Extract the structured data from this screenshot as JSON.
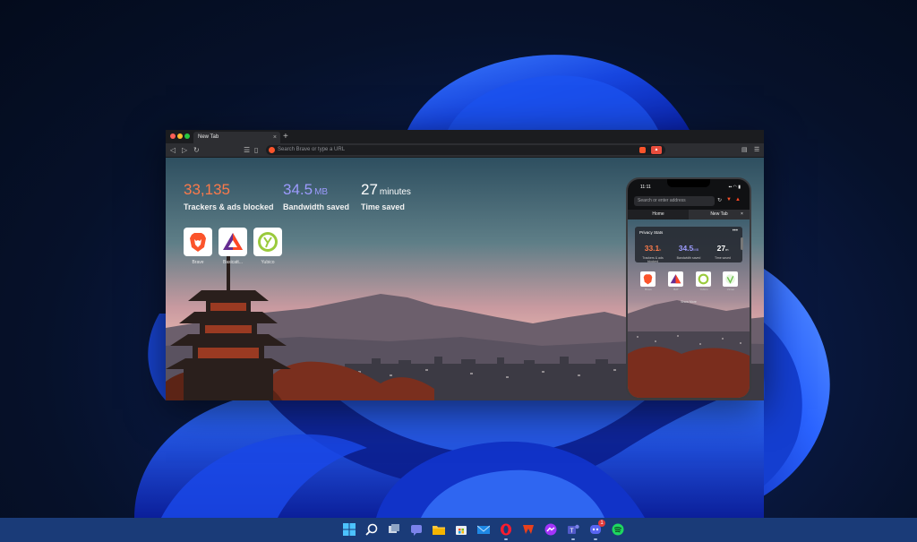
{
  "browser": {
    "tab_title": "New Tab",
    "tab_close": "×",
    "new_tab": "+",
    "url_placeholder": "Search Brave or type a URL",
    "nav": {
      "back": "◁",
      "forward": "▷",
      "reload": "↻",
      "bookmarks": "☰",
      "bookmark_add": "▯"
    },
    "menu": "☰",
    "wallet": "▤"
  },
  "stats": {
    "trackers": {
      "value": "33,135",
      "unit": "",
      "label": "Trackers & ads blocked",
      "color": "#fb7a4b"
    },
    "bandwidth": {
      "value": "34.5",
      "unit": "MB",
      "label": "Bandwidth saved",
      "color": "#9c9bfd"
    },
    "time": {
      "value": "27",
      "unit": "minutes",
      "label": "Time saved",
      "color": "#ffffff"
    }
  },
  "top_sites": [
    {
      "label": "Brave",
      "icon": "brave-lion-icon"
    },
    {
      "label": "Basicatt...",
      "icon": "bat-triangle-icon"
    },
    {
      "label": "Yubico",
      "icon": "yubico-icon"
    }
  ],
  "phone": {
    "time": "11:11",
    "signal": "▪▪ ◠ ▮",
    "url_placeholder": "Search or enter address",
    "tabs": [
      "Home",
      "New Tab"
    ],
    "tab_close": "×",
    "card_title": "Privacy Stats",
    "card_more": "•••",
    "stats": [
      {
        "value": "33.1",
        "unit": "k",
        "label": "Trackers & ads blocked",
        "color": "#fb7a4b"
      },
      {
        "value": "34.5",
        "unit": "MB",
        "label": "Bandwidth saved",
        "color": "#9c9bfd"
      },
      {
        "value": "27",
        "unit": "m",
        "label": "Time saved",
        "color": "#ffffff"
      }
    ],
    "tiles": [
      "Brave",
      "BAT",
      "Yubico",
      "Vimeo"
    ],
    "show_more": "Show More"
  },
  "taskbar": {
    "icons": [
      "windows-start-icon",
      "search-icon",
      "task-view-icon",
      "teams-chat-icon",
      "file-explorer-icon",
      "store-icon",
      "mail-icon",
      "opera-icon",
      "office-icon",
      "messenger-icon",
      "teams-icon",
      "discord-icon",
      "spotify-icon"
    ],
    "discord_badge": "1"
  },
  "colors": {
    "brave_orange": "#fb542b",
    "taskbar": "#1a3b78"
  }
}
